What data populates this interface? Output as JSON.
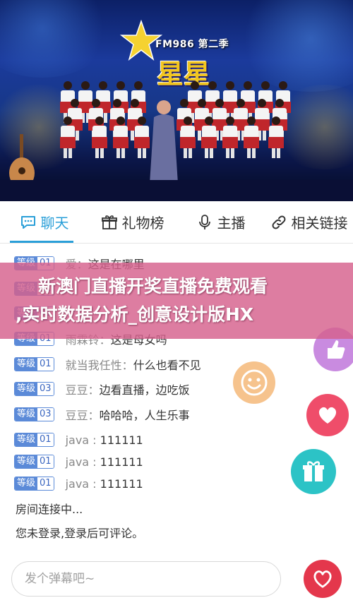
{
  "video": {
    "logo_text": "FM986 第二季",
    "title_text": "星星"
  },
  "tabs": [
    {
      "label": "聊天",
      "icon": "chat-bubble-icon",
      "active": true
    },
    {
      "label": "礼物榜",
      "icon": "gift-icon",
      "active": false
    },
    {
      "label": "主播",
      "icon": "microphone-icon",
      "active": false
    },
    {
      "label": "相关链接",
      "icon": "link-icon",
      "active": false
    }
  ],
  "chat": {
    "badge_label": "等级",
    "messages": [
      {
        "level": "01",
        "user": "爱",
        "text": "这是在哪里"
      },
      {
        "level": "01",
        "user": "",
        "text": ""
      },
      {
        "level": "01",
        "user": "",
        "text": ""
      },
      {
        "level": "01",
        "user": "雨霖铃",
        "text": "这是母女吗"
      },
      {
        "level": "01",
        "user": "就当我任性",
        "text": "什么也看不见"
      },
      {
        "level": "03",
        "user": "豆豆",
        "text": "边看直播，边吃饭"
      },
      {
        "level": "03",
        "user": "豆豆",
        "text": "哈哈哈，人生乐事"
      },
      {
        "level": "01",
        "user": "java",
        "text": "111111"
      },
      {
        "level": "01",
        "user": "java",
        "text": "111111"
      },
      {
        "level": "01",
        "user": "java",
        "text": "111111"
      }
    ],
    "system": [
      "房间连接中...",
      "您未登录,登录后可评论。"
    ]
  },
  "banner": {
    "line1": "新澳门直播开奖直播免费观看",
    "line2": ",实时数据分析_创意设计版HX"
  },
  "input": {
    "placeholder": "发个弹幕吧~"
  },
  "colors": {
    "accent": "#2a9fd8",
    "badge": "#5b8ad8",
    "heart": "#e4374c",
    "banner": "#d6608c",
    "smile": "#f6c38d",
    "gift": "#2cc3c6",
    "thumb": "#c98be0"
  },
  "float_icons": [
    "smile-icon",
    "thumbs-up-icon",
    "heart-icon",
    "gift-icon"
  ]
}
